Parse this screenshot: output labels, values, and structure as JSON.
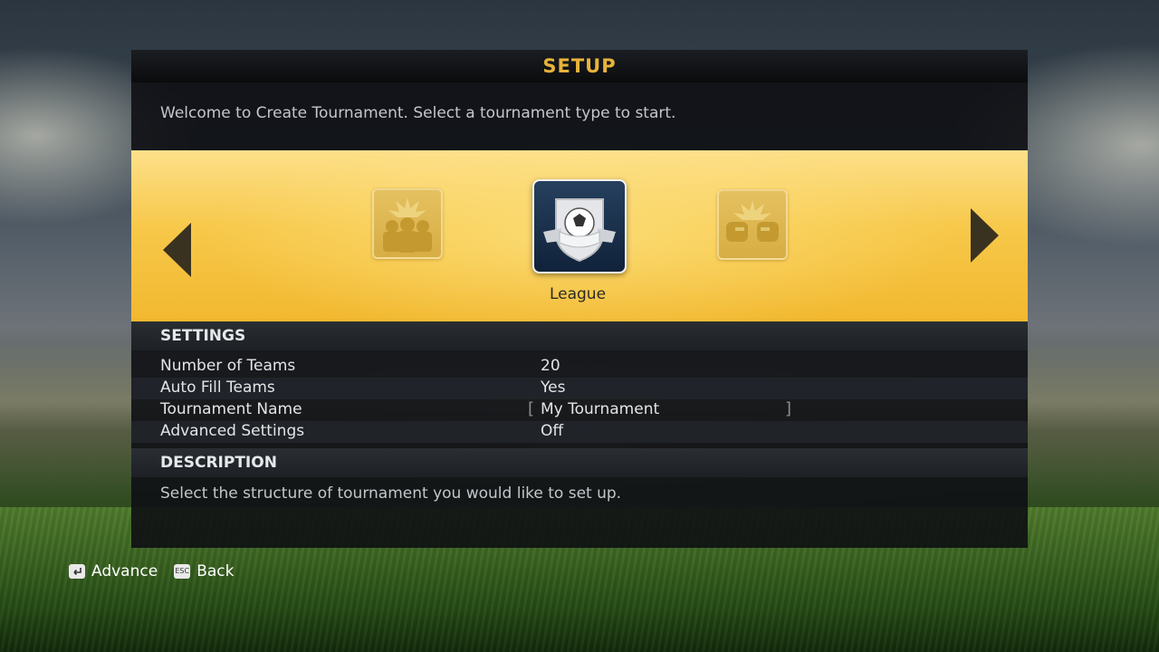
{
  "header": {
    "title": "SETUP"
  },
  "intro": "Welcome to Create Tournament.  Select a tournament type to start.",
  "carousel": {
    "selected_label": "League",
    "prev_icon": "cup-crowd-icon",
    "selected_icon": "league-shield-icon",
    "next_icon": "knockout-fists-icon"
  },
  "settings": {
    "heading": "SETTINGS",
    "rows": [
      {
        "label": "Number of Teams",
        "value": "20"
      },
      {
        "label": "Auto Fill Teams",
        "value": "Yes"
      },
      {
        "label": "Tournament Name",
        "value": "My Tournament"
      },
      {
        "label": "Advanced Settings",
        "value": "Off"
      }
    ]
  },
  "description": {
    "heading": "DESCRIPTION",
    "text": "Select the structure of tournament you would like to set up."
  },
  "footer": {
    "advance": {
      "key_icon": "enter-key-icon",
      "label": "Advance"
    },
    "back": {
      "key_icon": "esc-key-icon",
      "key_text": "ESC",
      "label": "Back"
    }
  },
  "colors": {
    "accent": "#e8b33a",
    "carousel": "#f7c84a",
    "panel": "#0e1014"
  }
}
